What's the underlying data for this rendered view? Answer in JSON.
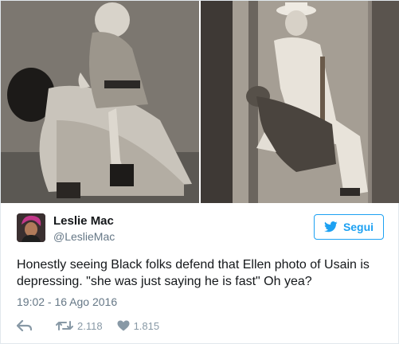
{
  "photos": {
    "left_alt": "",
    "right_alt": ""
  },
  "author": {
    "display_name": "Leslie Mac",
    "handle": "@LeslieMac"
  },
  "follow_button": {
    "label": "Segui",
    "accent_color": "#1da1f2"
  },
  "tweet": {
    "text": "Honestly seeing Black folks defend that Ellen photo of Usain is depressing. \"she was just saying he is fast\" Oh yea?",
    "timestamp": "19:02 - 16 Ago 2016"
  },
  "actions": {
    "reply_icon": "reply-icon",
    "retweet_count": "2.118",
    "like_count": "1.815"
  }
}
